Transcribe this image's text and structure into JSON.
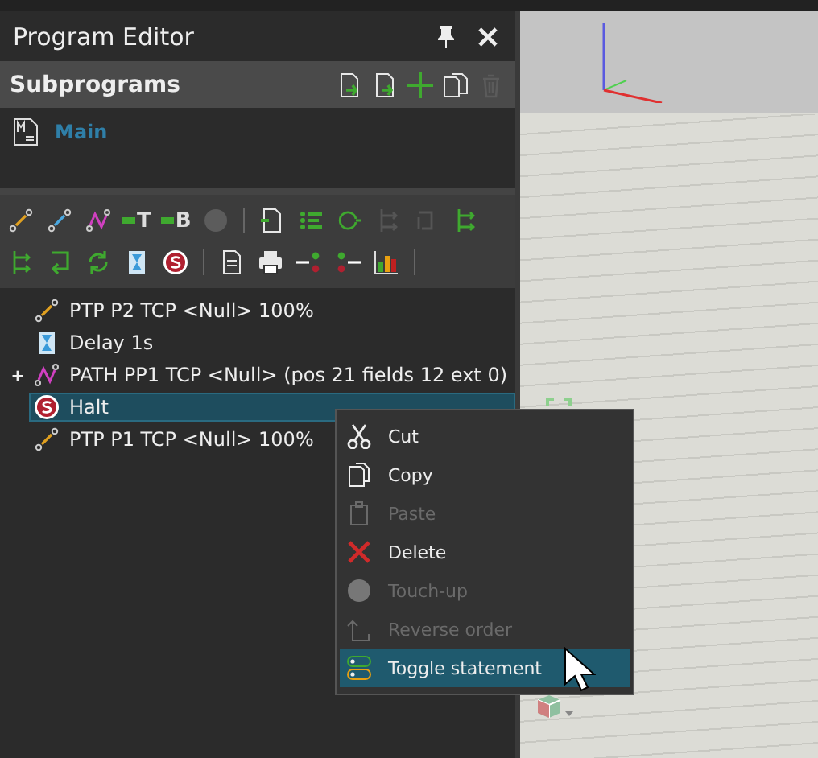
{
  "panel": {
    "title": "Program Editor"
  },
  "subprograms": {
    "title": "Subprograms",
    "tools": [
      {
        "kind": "import",
        "disabled": false
      },
      {
        "kind": "export",
        "disabled": false
      },
      {
        "kind": "add",
        "disabled": false
      },
      {
        "kind": "duplicate",
        "disabled": false
      },
      {
        "kind": "trash",
        "disabled": true
      }
    ],
    "items": [
      {
        "label": "Main",
        "selected": false
      }
    ]
  },
  "toolbar": [
    [
      {
        "kind": "ptp",
        "disabled": false
      },
      {
        "kind": "lin",
        "disabled": false
      },
      {
        "kind": "path",
        "disabled": false
      },
      {
        "kind": "text",
        "label": "T",
        "disabled": false
      },
      {
        "kind": "text",
        "label": "B",
        "disabled": false
      },
      {
        "kind": "dot",
        "disabled": true
      },
      {
        "kind": "sep"
      },
      {
        "kind": "sub",
        "disabled": false
      },
      {
        "kind": "list",
        "disabled": false
      },
      {
        "kind": "loop",
        "disabled": false
      },
      {
        "kind": "branch",
        "disabled": true
      },
      {
        "kind": "swap",
        "disabled": true
      },
      {
        "kind": "fork",
        "disabled": false
      }
    ],
    [
      {
        "kind": "fork",
        "disabled": false
      },
      {
        "kind": "return",
        "disabled": false
      },
      {
        "kind": "cycle",
        "disabled": false
      },
      {
        "kind": "hourglass",
        "disabled": false
      },
      {
        "kind": "stop",
        "disabled": false
      },
      {
        "kind": "sep"
      },
      {
        "kind": "doc",
        "disabled": false
      },
      {
        "kind": "printer",
        "disabled": false
      },
      {
        "kind": "in",
        "disabled": false
      },
      {
        "kind": "out",
        "disabled": false
      },
      {
        "kind": "chart",
        "disabled": false
      },
      {
        "kind": "sep"
      }
    ]
  ],
  "statements": [
    {
      "kind": "ptp",
      "label": "PTP P2 TCP <Null> 100%",
      "selected": false
    },
    {
      "kind": "hourglass",
      "label": "Delay 1s",
      "selected": false
    },
    {
      "kind": "path",
      "label": "PATH PP1 TCP <Null> (pos 21 fields 12 ext 0)",
      "expander": "+",
      "selected": false
    },
    {
      "kind": "stop",
      "label": "Halt",
      "selected": true
    },
    {
      "kind": "ptp",
      "label": "PTP P1 TCP <Null> 100%",
      "selected": false
    }
  ],
  "context_menu": [
    {
      "kind": "cut",
      "label": "Cut",
      "disabled": false,
      "selected": false
    },
    {
      "kind": "copy",
      "label": "Copy",
      "disabled": false,
      "selected": false
    },
    {
      "kind": "paste",
      "label": "Paste",
      "disabled": true,
      "selected": false
    },
    {
      "kind": "delete",
      "label": "Delete",
      "disabled": false,
      "selected": false
    },
    {
      "kind": "dot",
      "label": "Touch-up",
      "disabled": true,
      "selected": false
    },
    {
      "kind": "reverse",
      "label": "Reverse order",
      "disabled": true,
      "selected": false
    },
    {
      "kind": "toggle",
      "label": "Toggle statement",
      "disabled": false,
      "selected": true
    }
  ]
}
